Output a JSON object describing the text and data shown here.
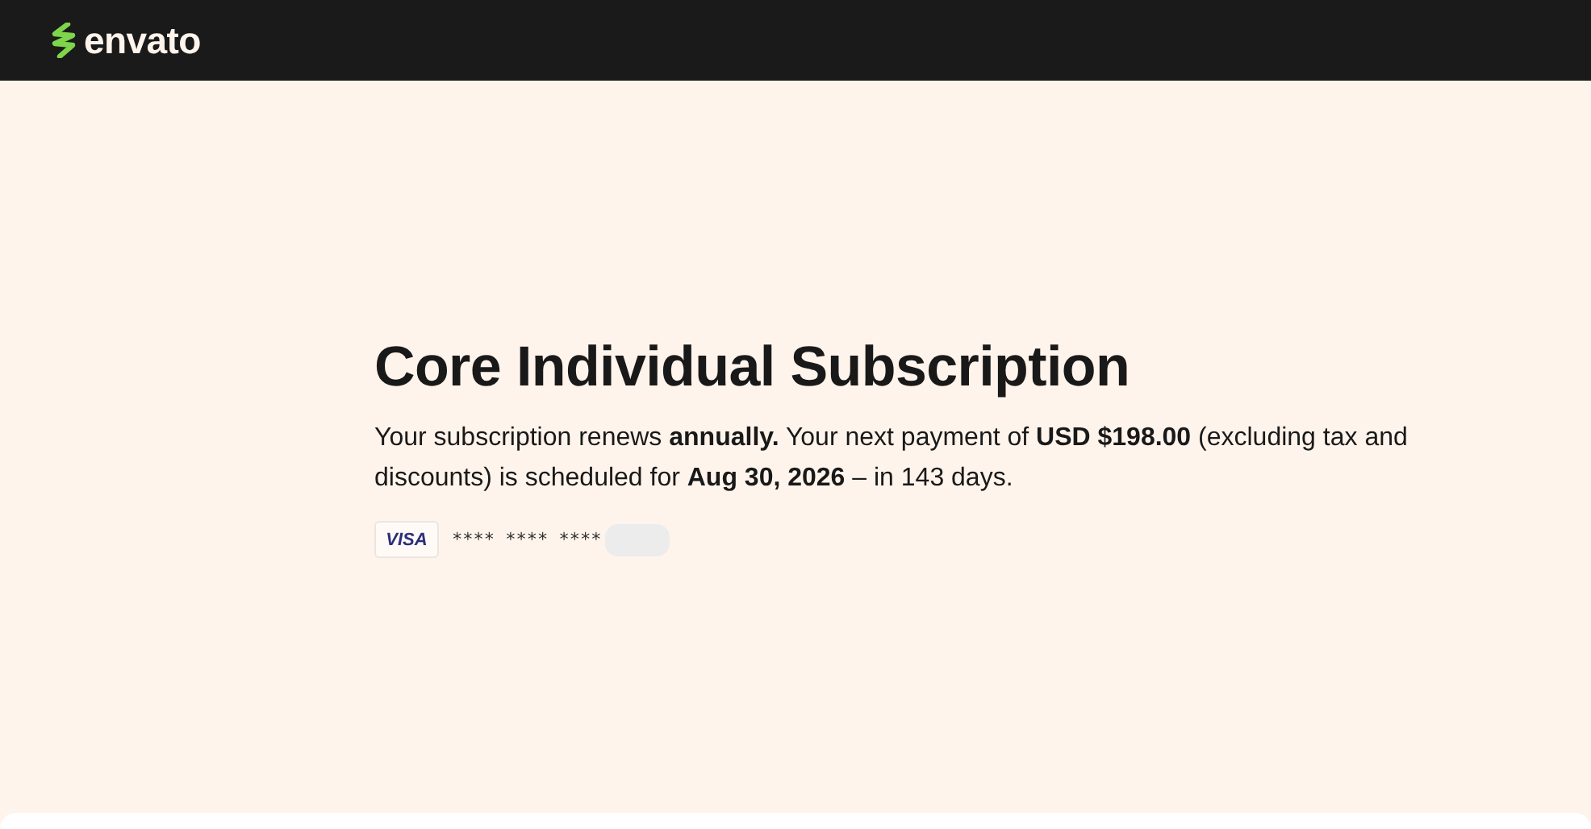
{
  "header": {
    "logo": "envato"
  },
  "subscription": {
    "title": "Core Individual Subscription",
    "description": "Your subscription renews **annually.** Your next payment of **USD $198.00** (excluding tax and discounts) is scheduled for **Aug 30, 2026** – in 143 days.",
    "card": {
      "brand": "VISA",
      "number": "**** **** ****",
      "masked": true
    }
  }
}
